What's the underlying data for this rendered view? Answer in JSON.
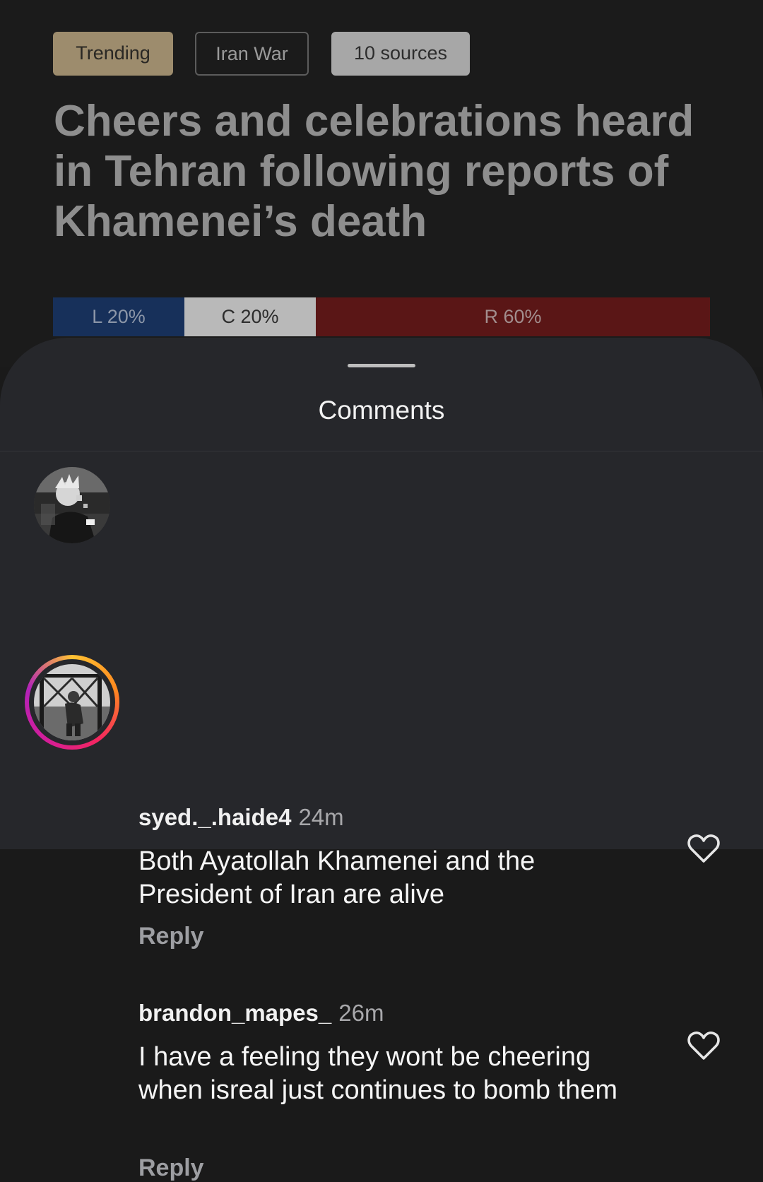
{
  "article": {
    "tags": {
      "trending": "Trending",
      "topic": "Iran War",
      "sources": "10 sources"
    },
    "headline": "Cheers and celebrations heard in Tehran following reports of Khamenei’s death",
    "bias": {
      "left": {
        "label": "L 20%",
        "percent": 20,
        "color": "#17305a",
        "text_color": "#8c96a8"
      },
      "center": {
        "label": "C 20%",
        "percent": 20,
        "color": "#b9b9b9",
        "text_color": "#2c2c2c"
      },
      "right": {
        "label": "R 60%",
        "percent": 60,
        "color": "#5a1616",
        "text_color": "#a28e8e"
      }
    }
  },
  "comments_sheet": {
    "title": "Comments",
    "comments": [
      {
        "username": "syed._.haide4",
        "time": "24m",
        "text": "Both Ayatollah Khamenei and the President of Iran are alive",
        "reply": "Reply",
        "has_story_ring": false
      },
      {
        "username": "brandon_mapes_",
        "time": "26m",
        "text": "I have a feeling they wont be cheering when isreal just continues to bomb them",
        "reply": "Reply",
        "has_story_ring": true
      }
    ]
  },
  "icons": {
    "like": "heart-outline-icon"
  }
}
